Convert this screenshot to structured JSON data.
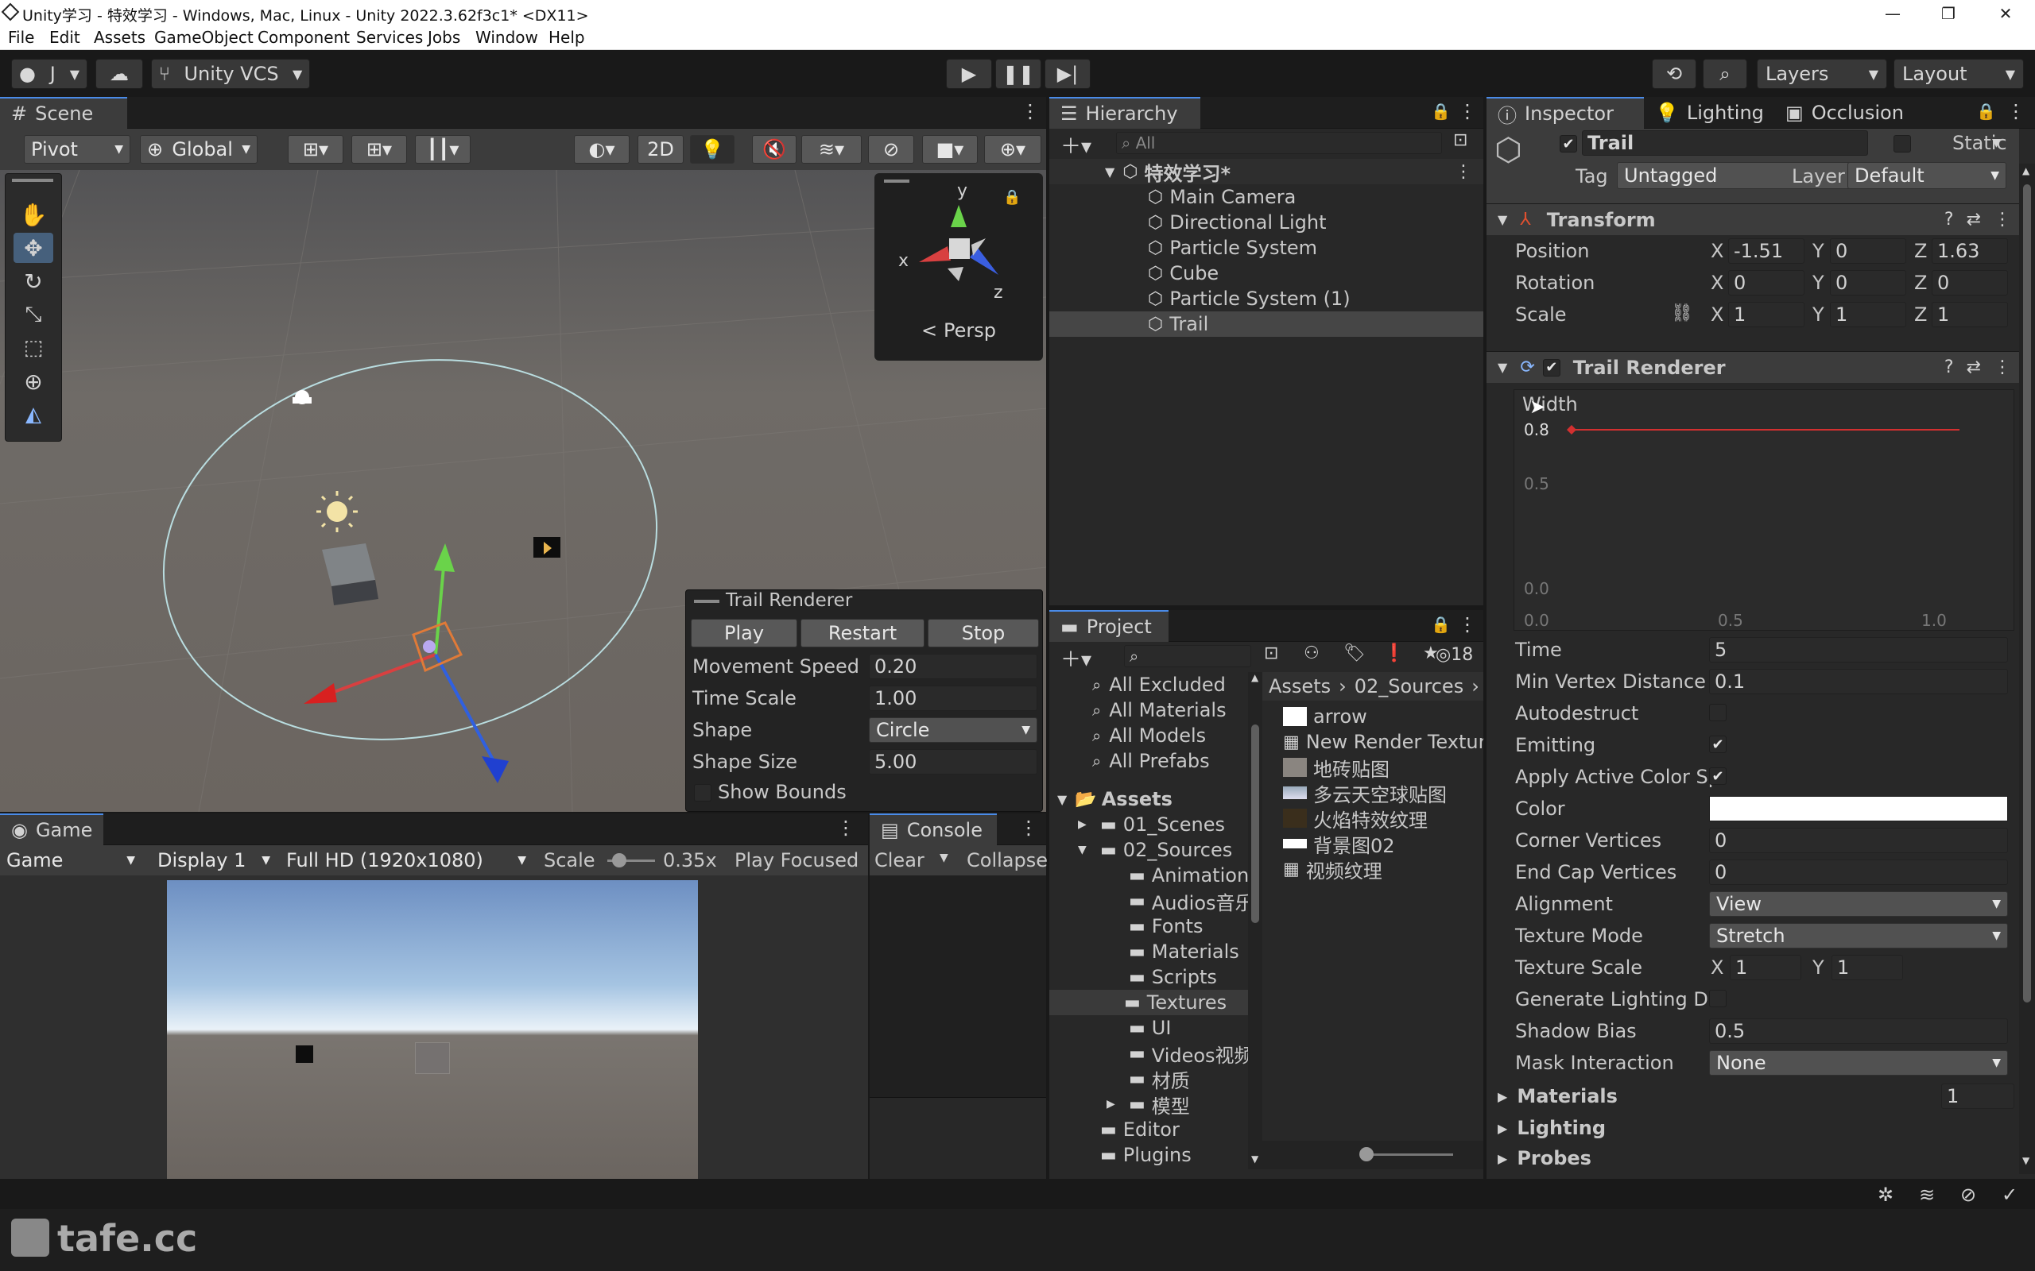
{
  "window": {
    "title": "Unity学习 - 特效学习 - Windows, Mac, Linux - Unity 2022.3.62f3c1* <DX11>",
    "controls": [
      "—",
      "❐",
      "✕"
    ]
  },
  "menu": [
    "File",
    "Edit",
    "Assets",
    "GameObject",
    "Component",
    "Services",
    "Jobs",
    "Window",
    "Help"
  ],
  "toolbar": {
    "account": "J",
    "vcs": "Unity VCS",
    "layers": "Layers",
    "layout": "Layout"
  },
  "scene": {
    "tab": "Scene",
    "pivot": "Pivot",
    "global": "Global",
    "mode2d": "2D",
    "persp": "Persp",
    "gizmo_y": "y",
    "gizmo_x": "x",
    "gizmo_z": "z"
  },
  "overlay": {
    "title": "Trail Renderer",
    "play": "Play",
    "restart": "Restart",
    "stop": "Stop",
    "rows": [
      {
        "label": "Movement Speed",
        "value": "0.20"
      },
      {
        "label": "Time Scale",
        "value": "1.00"
      },
      {
        "label": "Shape",
        "value": "Circle"
      },
      {
        "label": "Shape Size",
        "value": "5.00"
      }
    ],
    "show_bounds": "Show Bounds"
  },
  "game": {
    "tab": "Game",
    "mode": "Game",
    "display": "Display 1",
    "resolution": "Full HD (1920x1080)",
    "scale_label": "Scale",
    "scale": "0.35x",
    "play_focused": "Play Focused",
    "scale_fraction": 0.1
  },
  "console": {
    "tab": "Console",
    "clear": "Clear",
    "collapse": "Collapse"
  },
  "hierarchy": {
    "tab": "Hierarchy",
    "search": "All",
    "scene": "特效学习*",
    "items": [
      "Main Camera",
      "Directional Light",
      "Particle System",
      "Cube",
      "Particle System (1)",
      "Trail"
    ]
  },
  "project": {
    "tab": "Project",
    "count": "18",
    "favorites": [
      "All Excluded",
      "All Materials",
      "All Models",
      "All Prefabs"
    ],
    "tree": {
      "root": "Assets",
      "folders": [
        {
          "name": "01_Scenes",
          "level": 1,
          "arrow": "▶"
        },
        {
          "name": "02_Sources",
          "level": 1,
          "arrow": "▼"
        },
        {
          "name": "Animation",
          "level": 2,
          "arrow": ""
        },
        {
          "name": "Audios音乐",
          "level": 2,
          "arrow": ""
        },
        {
          "name": "Fonts",
          "level": 2,
          "arrow": ""
        },
        {
          "name": "Materials",
          "level": 2,
          "arrow": ""
        },
        {
          "name": "Scripts",
          "level": 2,
          "arrow": ""
        },
        {
          "name": "Textures",
          "level": 2,
          "arrow": ""
        },
        {
          "name": "UI",
          "level": 2,
          "arrow": ""
        },
        {
          "name": "Videos视频",
          "level": 2,
          "arrow": ""
        },
        {
          "name": "材质",
          "level": 2,
          "arrow": ""
        },
        {
          "name": "模型",
          "level": 2,
          "arrow": "▶"
        },
        {
          "name": "Editor",
          "level": 1,
          "arrow": ""
        },
        {
          "name": "Plugins",
          "level": 1,
          "arrow": ""
        }
      ]
    },
    "breadcrumb": [
      "Assets",
      "02_Sources"
    ],
    "files": [
      "arrow",
      "New Render Texture",
      "地砖贴图",
      "多云天空球贴图",
      "火焰特效纹理",
      "背景图02",
      "视频纹理"
    ]
  },
  "inspector": {
    "tabs": [
      "Inspector",
      "Lighting",
      "Occlusion"
    ],
    "name": "Trail",
    "static": "Static",
    "tag_label": "Tag",
    "tag": "Untagged",
    "layer_label": "Layer",
    "layer": "Default",
    "transform": {
      "title": "Transform",
      "rows": [
        {
          "label": "Position",
          "x": "-1.51",
          "y": "0",
          "z": "1.63"
        },
        {
          "label": "Rotation",
          "x": "0",
          "y": "0",
          "z": "0"
        },
        {
          "label": "Scale",
          "x": "1",
          "y": "1",
          "z": "1"
        }
      ],
      "axes": [
        "X",
        "Y",
        "Z"
      ]
    },
    "trail": {
      "title": "Trail Renderer",
      "width_label": "Width",
      "width_value": 0.8,
      "curve_y": [
        "0.8",
        "0.5",
        "0.0"
      ],
      "curve_x": [
        "0.0",
        "0.5",
        "1.0"
      ],
      "time_label": "Time",
      "time": "5",
      "minvertex_label": "Min Vertex Distance",
      "minvertex": "0.1",
      "autodestruct_label": "Autodestruct",
      "autodestruct": false,
      "emitting_label": "Emitting",
      "emitting": true,
      "applycolor_label": "Apply Active Color Sp",
      "applycolor": true,
      "color_label": "Color",
      "color": "#ffffff",
      "corner_label": "Corner Vertices",
      "corner": "0",
      "endcap_label": "End Cap Vertices",
      "endcap": "0",
      "alignment_label": "Alignment",
      "alignment": "View",
      "texmode_label": "Texture Mode",
      "texmode": "Stretch",
      "texscale_label": "Texture Scale",
      "texscale_x": "1",
      "texscale_y": "1",
      "genlight_label": "Generate Lighting Da",
      "genlight": false,
      "shadowbias_label": "Shadow Bias",
      "shadowbias": "0.5",
      "mask_label": "Mask Interaction",
      "mask": "None",
      "materials_label": "Materials",
      "materials_count": "1",
      "lighting_label": "Lighting",
      "probes_label": "Probes"
    }
  },
  "watermark": "tafe.cc",
  "colors": {
    "accent": "#4a8be8",
    "panel": "#282828",
    "dark": "#191919",
    "selection": "#3a3a3a",
    "curve": "#d23030"
  }
}
